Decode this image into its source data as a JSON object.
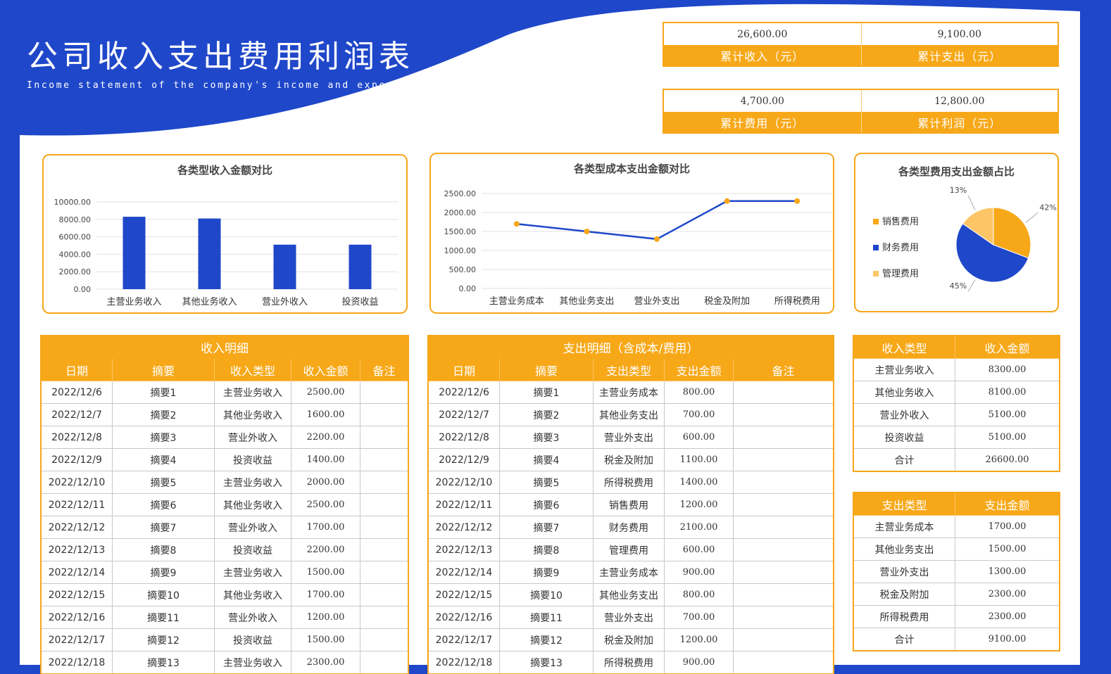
{
  "header": {
    "title": "公司收入支出费用利润表",
    "subtitle": "Income statement of the company's income and expenses"
  },
  "kpis": [
    {
      "value": "26,600.00",
      "label": "累计收入（元）"
    },
    {
      "value": "9,100.00",
      "label": "累计支出（元）"
    },
    {
      "value": "4,700.00",
      "label": "累计费用（元）"
    },
    {
      "value": "12,800.00",
      "label": "累计利润（元）"
    }
  ],
  "colors": {
    "background_blue": "#1f47c9",
    "accent_orange": "#f7a818",
    "bar_blue": "#1f47c9",
    "pie_light": "#fdc566"
  },
  "chart_data": [
    {
      "type": "bar",
      "title": "各类型收入金额对比",
      "categories": [
        "主营业务收入",
        "其他业务收入",
        "营业外收入",
        "投资收益"
      ],
      "values": [
        8300,
        8100,
        5100,
        5100
      ],
      "ylim": [
        0,
        10000
      ],
      "yticks": [
        "0.00",
        "2000.00",
        "4000.00",
        "6000.00",
        "8000.00",
        "10000.00"
      ],
      "grid": true
    },
    {
      "type": "line",
      "title": "各类型成本支出金额对比",
      "categories": [
        "主营业务成本",
        "其他业务支出",
        "营业外支出",
        "税金及附加",
        "所得税费用"
      ],
      "values": [
        1700,
        1500,
        1300,
        2300,
        2300
      ],
      "ylim": [
        0,
        2500
      ],
      "yticks": [
        "0.00",
        "500.00",
        "1000.00",
        "1500.00",
        "2000.00",
        "2500.00"
      ],
      "grid": true
    },
    {
      "type": "pie",
      "title": "各类型费用支出金额占比",
      "legend_position": "left",
      "slices": [
        {
          "name": "销售费用",
          "value": 1200,
          "label": "42%",
          "color": "#f7a818"
        },
        {
          "name": "财务费用",
          "value": 2100,
          "label": "45%",
          "color": "#1f47c9"
        },
        {
          "name": "管理费用",
          "value": 600,
          "label": "13%",
          "color": "#fdc566"
        }
      ]
    }
  ],
  "income_table": {
    "caption": "收入明细",
    "columns": [
      "日期",
      "摘要",
      "收入类型",
      "收入金额",
      "备注"
    ],
    "rows": [
      [
        "2022/12/6",
        "摘要1",
        "主营业务收入",
        "2500.00",
        ""
      ],
      [
        "2022/12/7",
        "摘要2",
        "其他业务收入",
        "1600.00",
        ""
      ],
      [
        "2022/12/8",
        "摘要3",
        "营业外收入",
        "2200.00",
        ""
      ],
      [
        "2022/12/9",
        "摘要4",
        "投资收益",
        "1400.00",
        ""
      ],
      [
        "2022/12/10",
        "摘要5",
        "主营业务收入",
        "2000.00",
        ""
      ],
      [
        "2022/12/11",
        "摘要6",
        "其他业务收入",
        "2500.00",
        ""
      ],
      [
        "2022/12/12",
        "摘要7",
        "营业外收入",
        "1700.00",
        ""
      ],
      [
        "2022/12/13",
        "摘要8",
        "投资收益",
        "2200.00",
        ""
      ],
      [
        "2022/12/14",
        "摘要9",
        "主营业务收入",
        "1500.00",
        ""
      ],
      [
        "2022/12/15",
        "摘要10",
        "其他业务收入",
        "1700.00",
        ""
      ],
      [
        "2022/12/16",
        "摘要11",
        "营业外收入",
        "1200.00",
        ""
      ],
      [
        "2022/12/17",
        "摘要12",
        "投资收益",
        "1500.00",
        ""
      ],
      [
        "2022/12/18",
        "摘要13",
        "主营业务收入",
        "2300.00",
        ""
      ]
    ]
  },
  "expense_table": {
    "caption": "支出明细（含成本/费用）",
    "columns": [
      "日期",
      "摘要",
      "支出类型",
      "支出金额",
      "备注"
    ],
    "rows": [
      [
        "2022/12/6",
        "摘要1",
        "主营业务成本",
        "800.00",
        ""
      ],
      [
        "2022/12/7",
        "摘要2",
        "其他业务支出",
        "700.00",
        ""
      ],
      [
        "2022/12/8",
        "摘要3",
        "营业外支出",
        "600.00",
        ""
      ],
      [
        "2022/12/9",
        "摘要4",
        "税金及附加",
        "1100.00",
        ""
      ],
      [
        "2022/12/10",
        "摘要5",
        "所得税费用",
        "1400.00",
        ""
      ],
      [
        "2022/12/11",
        "摘要6",
        "销售费用",
        "1200.00",
        ""
      ],
      [
        "2022/12/12",
        "摘要7",
        "财务费用",
        "2100.00",
        ""
      ],
      [
        "2022/12/13",
        "摘要8",
        "管理费用",
        "600.00",
        ""
      ],
      [
        "2022/12/14",
        "摘要9",
        "主营业务成本",
        "900.00",
        ""
      ],
      [
        "2022/12/15",
        "摘要10",
        "其他业务支出",
        "800.00",
        ""
      ],
      [
        "2022/12/16",
        "摘要11",
        "营业外支出",
        "700.00",
        ""
      ],
      [
        "2022/12/17",
        "摘要12",
        "税金及附加",
        "1200.00",
        ""
      ],
      [
        "2022/12/18",
        "摘要13",
        "所得税费用",
        "900.00",
        ""
      ]
    ]
  },
  "income_summary": {
    "columns": [
      "收入类型",
      "收入金额"
    ],
    "rows": [
      [
        "主营业务收入",
        "8300.00"
      ],
      [
        "其他业务收入",
        "8100.00"
      ],
      [
        "营业外收入",
        "5100.00"
      ],
      [
        "投资收益",
        "5100.00"
      ],
      [
        "合计",
        "26600.00"
      ]
    ]
  },
  "expense_summary": {
    "columns": [
      "支出类型",
      "支出金额"
    ],
    "rows": [
      [
        "主营业务成本",
        "1700.00"
      ],
      [
        "其他业务支出",
        "1500.00"
      ],
      [
        "营业外支出",
        "1300.00"
      ],
      [
        "税金及附加",
        "2300.00"
      ],
      [
        "所得税费用",
        "2300.00"
      ],
      [
        "合计",
        "9100.00"
      ]
    ]
  }
}
